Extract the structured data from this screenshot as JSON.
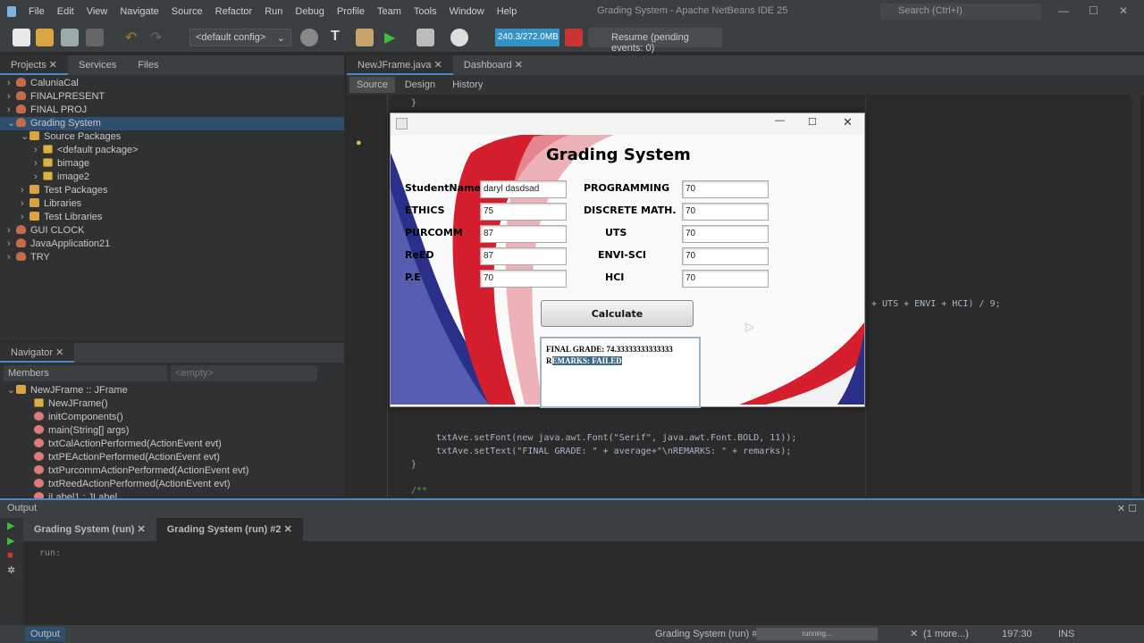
{
  "menu": [
    "File",
    "Edit",
    "View",
    "Navigate",
    "Source",
    "Refactor",
    "Run",
    "Debug",
    "Profile",
    "Team",
    "Tools",
    "Window",
    "Help"
  ],
  "window_title": "Grading System - Apache NetBeans IDE 25",
  "search_placeholder": "Search (Ctrl+I)",
  "toolbar": {
    "config": "<default config>",
    "memory": "240.3/272.0MB",
    "resume": "Resume (pending events: 0)"
  },
  "projects": {
    "tabs": [
      "Projects",
      "Services",
      "Files"
    ],
    "items": [
      {
        "label": "CaluniaCal",
        "level": 0,
        "icon": "project"
      },
      {
        "label": "FINALPRESENT",
        "level": 0,
        "icon": "project"
      },
      {
        "label": "FINAL PROJ",
        "level": 0,
        "icon": "project"
      },
      {
        "label": "Grading System",
        "level": 0,
        "icon": "project",
        "selected": true
      },
      {
        "label": "Source Packages",
        "level": 1,
        "icon": "folder"
      },
      {
        "label": "<default package>",
        "level": 2,
        "icon": "package"
      },
      {
        "label": "bimage",
        "level": 2,
        "icon": "package"
      },
      {
        "label": "image2",
        "level": 2,
        "icon": "package"
      },
      {
        "label": "Test Packages",
        "level": 1,
        "icon": "folder"
      },
      {
        "label": "Libraries",
        "level": 1,
        "icon": "folder"
      },
      {
        "label": "Test Libraries",
        "level": 1,
        "icon": "folder"
      },
      {
        "label": "GUI CLOCK",
        "level": 0,
        "icon": "project"
      },
      {
        "label": "JavaApplication21",
        "level": 0,
        "icon": "project"
      },
      {
        "label": "TRY",
        "level": 0,
        "icon": "project"
      }
    ]
  },
  "navigator": {
    "title": "Navigator",
    "filter": "Members",
    "secondary": "<empty>",
    "items": [
      "NewJFrame :: JFrame",
      "NewJFrame()",
      "initComponents()",
      "main(String[] args)",
      "txtCalActionPerformed(ActionEvent evt)",
      "txtPEActionPerformed(ActionEvent evt)",
      "txtPurcommActionPerformed(ActionEvent evt)",
      "txtReedActionPerformed(ActionEvent evt)",
      "jLabel1 : JLabel"
    ]
  },
  "editor": {
    "tabs": [
      "NewJFrame.java",
      "Dashboard"
    ],
    "modes": [
      "Source",
      "Design",
      "History"
    ],
    "code": {
      "line1": "}",
      "line2": "+ UTS + ENVI + HCI) / 9;",
      "line3": "txtAve.setFont(new java.awt.Font(\"Serif\", java.awt.Font.BOLD, 11));",
      "line4": "txtAve.setText(\"FINAL GRADE: \" + average+\"\\nREMARKS: \" + remarks);",
      "line5": "}",
      "line6": "/**"
    }
  },
  "app": {
    "title": "Grading System",
    "left": [
      {
        "label": "StudentName",
        "value": "daryl dasdsad"
      },
      {
        "label": "ETHICS",
        "value": "75"
      },
      {
        "label": "PURCOMM",
        "value": "87"
      },
      {
        "label": "ReED",
        "value": "87"
      },
      {
        "label": "P.E",
        "value": "70"
      }
    ],
    "right": [
      {
        "label": "PROGRAMMING",
        "value": "70"
      },
      {
        "label": "DISCRETE MATH.",
        "value": "70"
      },
      {
        "label": "UTS",
        "value": "70"
      },
      {
        "label": "ENVI-SCI",
        "value": "70"
      },
      {
        "label": "HCI",
        "value": "70"
      }
    ],
    "calculate": "Calculate",
    "result_line1": "FINAL GRADE: 74.33333333333333",
    "result_r": "R",
    "result_line2_sel": "EMARKS: FAILED"
  },
  "output": {
    "title": "Output",
    "tabs": [
      "Grading System (run)",
      "Grading System (run) #2"
    ],
    "text": "run:"
  },
  "status": {
    "output_btn": "Output",
    "task": "Grading System (run) #2",
    "progress": "running...",
    "more": "(1 more...)",
    "position": "197:30",
    "mode": "INS"
  }
}
